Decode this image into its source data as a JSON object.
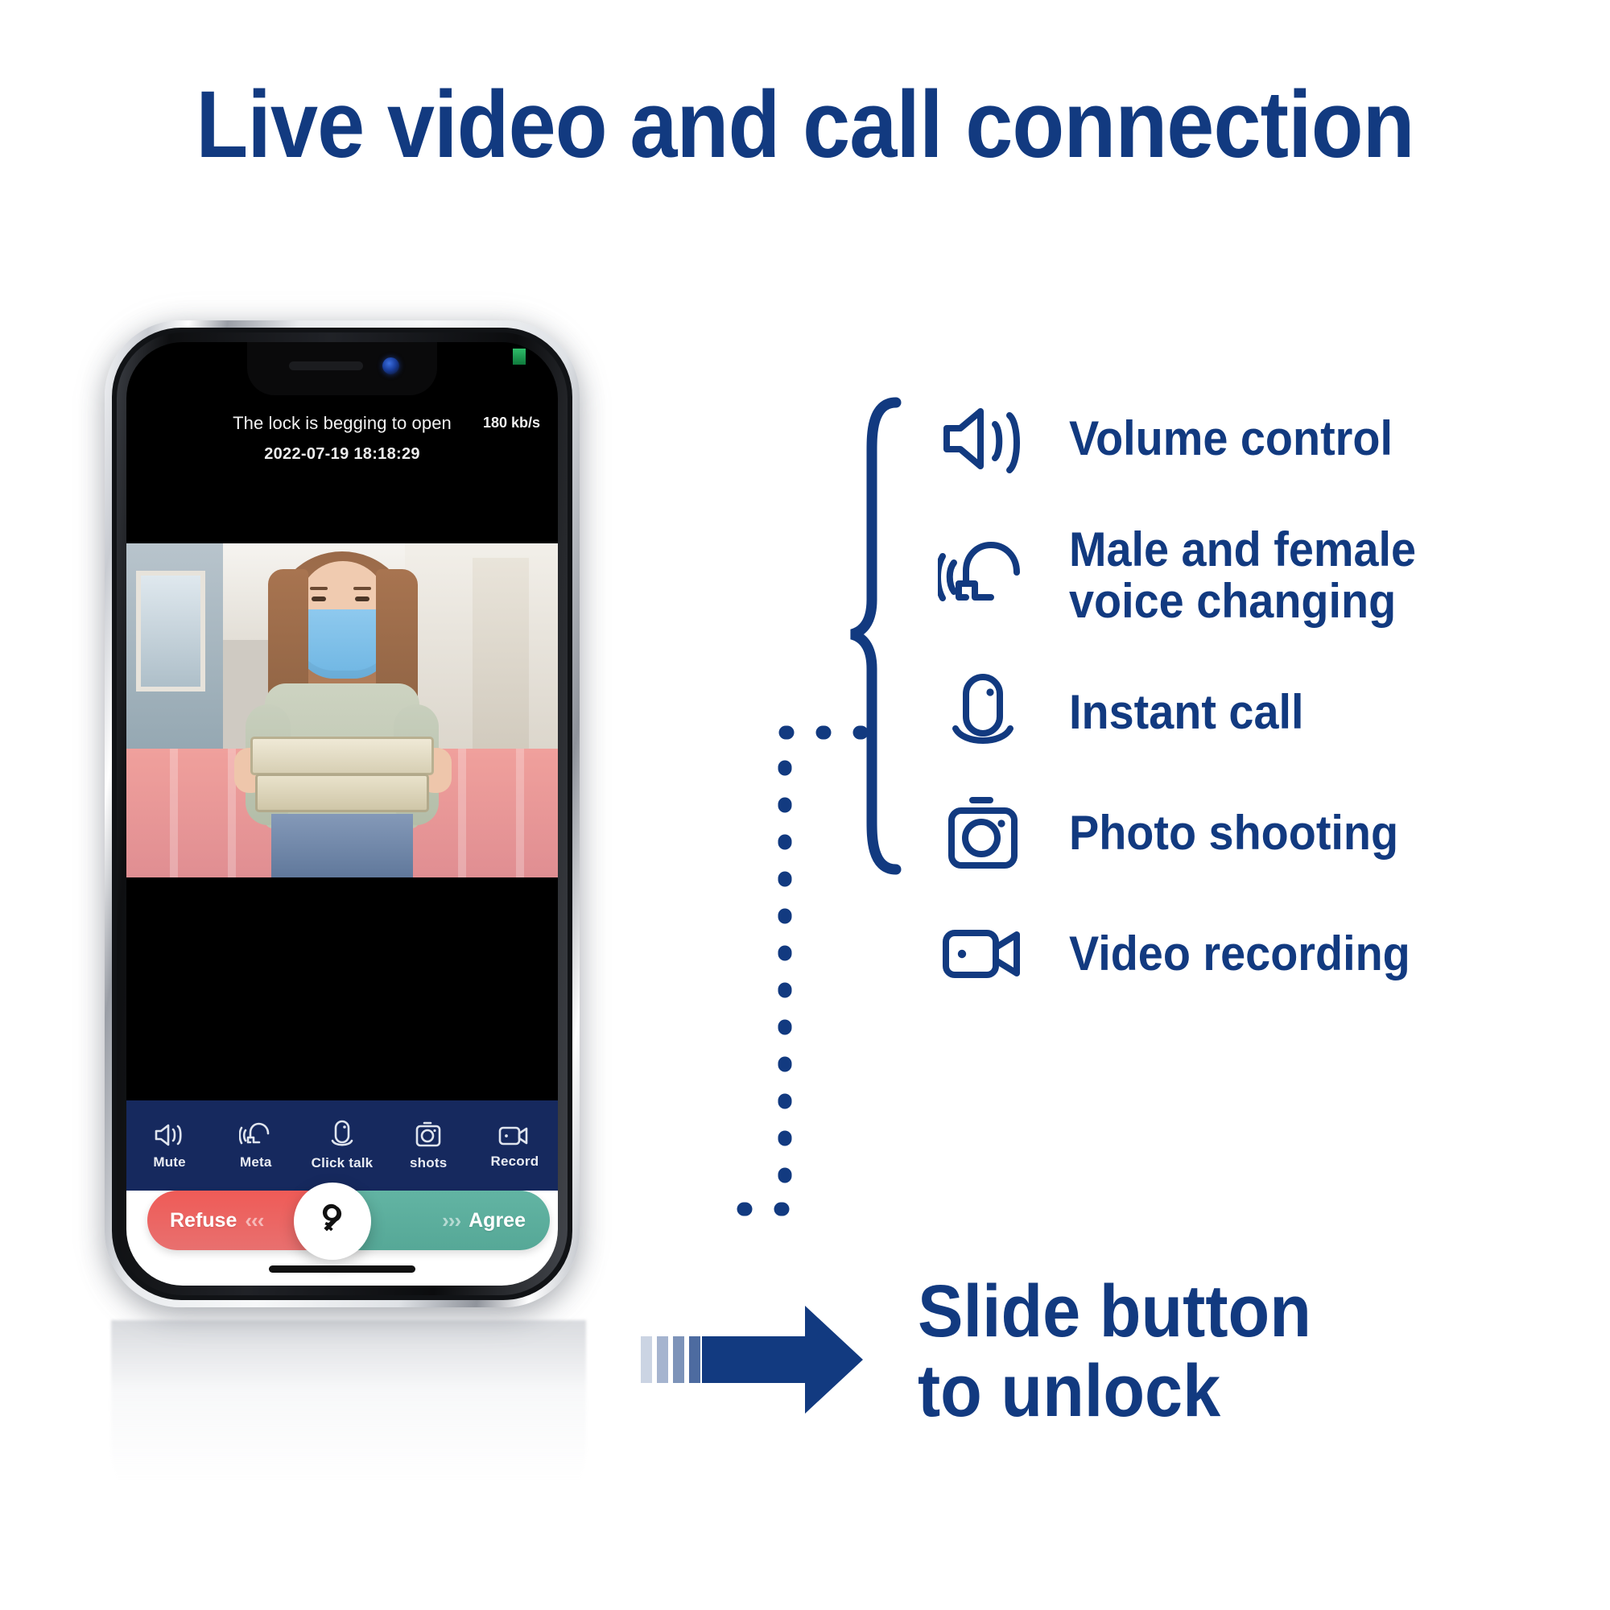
{
  "headline": "Live video and call connection",
  "theme": {
    "brand_navy": "#123A80",
    "toolbar_navy": "#16295E",
    "refuse_red": "#EF5B57",
    "agree_green": "#56A897"
  },
  "phone": {
    "status": {
      "title": "The lock is begging to open",
      "bitrate": "180 kb/s",
      "timestamp": "2022-07-19 18:18:29"
    },
    "toolbar": [
      {
        "label": "Mute",
        "icon": "speaker-icon"
      },
      {
        "label": "Meta",
        "icon": "voice-change-icon"
      },
      {
        "label": "Click talk",
        "icon": "microphone-icon"
      },
      {
        "label": "shots",
        "icon": "camera-icon"
      },
      {
        "label": "Record",
        "icon": "video-camera-icon"
      }
    ],
    "slider": {
      "refuse_label": "Refuse",
      "refuse_chevrons": "‹‹‹",
      "agree_label": "Agree",
      "agree_chevrons": "›››",
      "knob_icon": "key-icon"
    }
  },
  "features": [
    {
      "label": "Volume control",
      "icon": "speaker-icon"
    },
    {
      "label": "Male and female\nvoice changing",
      "icon": "voice-change-icon"
    },
    {
      "label": "Instant call",
      "icon": "microphone-icon"
    },
    {
      "label": "Photo shooting",
      "icon": "camera-icon"
    },
    {
      "label": "Video recording",
      "icon": "video-camera-icon"
    }
  ],
  "callout": {
    "slide_text": "Slide button\nto unlock",
    "arrow_icon": "arrow-right-icon"
  }
}
